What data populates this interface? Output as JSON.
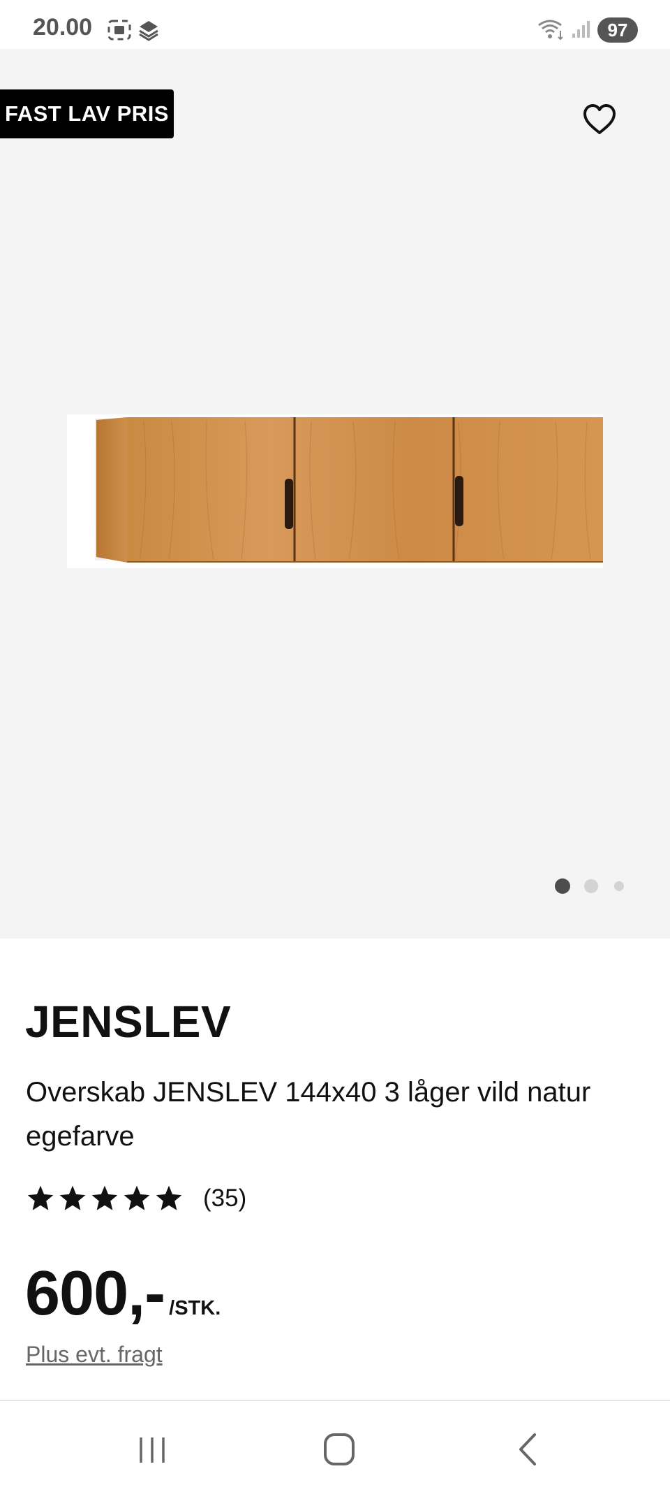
{
  "status_bar": {
    "time": "20.00",
    "battery": "97",
    "icons": [
      "screenshot-icon",
      "layers-icon",
      "wifi-icon",
      "cell-signal-icon"
    ]
  },
  "product": {
    "badge": "FAST LAV PRIS",
    "brand": "JENSLEV",
    "description": "Overskab JENSLEV 144x40 3 låger vild natur egefarve",
    "rating": {
      "stars": 5,
      "max_stars": 5,
      "count_text": "(35)"
    },
    "price": "600,-",
    "unit": "/STK.",
    "shipping_note": "Plus evt. fragt",
    "image_count": 3,
    "active_image": 1
  },
  "colors": {
    "gallery_bg": "#f4f4f4",
    "badge_bg": "#000000",
    "wood": "#cf8a40",
    "active_dot": "#4d4d4d",
    "inactive_dot": "#d3d3d3"
  },
  "nav": {
    "icons": [
      "recent-apps-icon",
      "home-icon",
      "back-icon"
    ]
  }
}
